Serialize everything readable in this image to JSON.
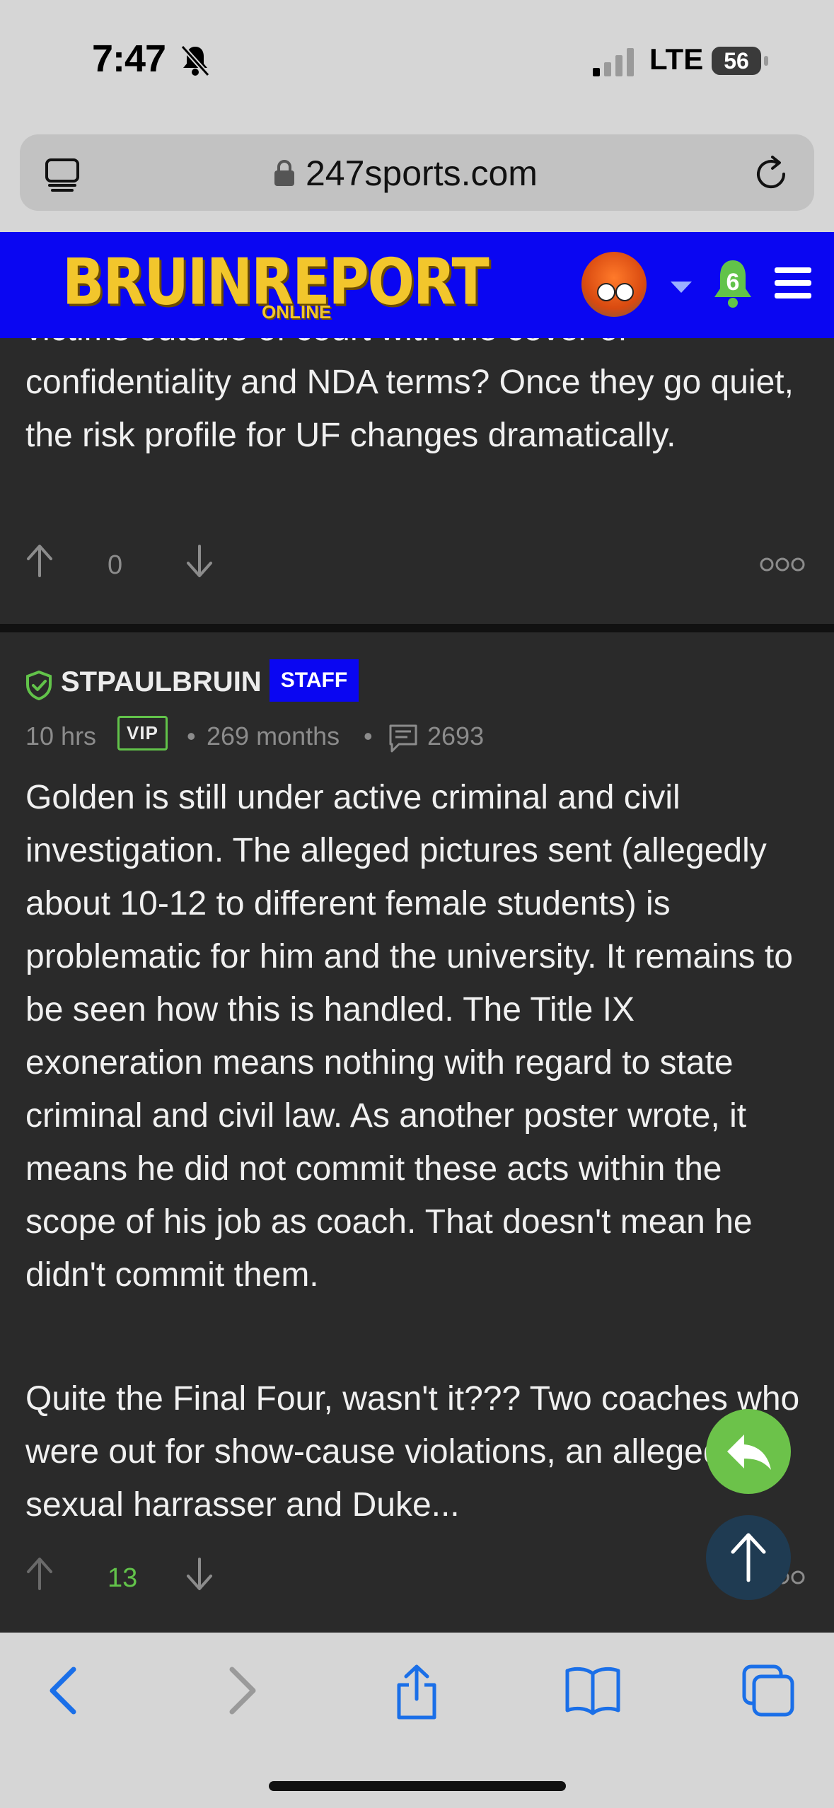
{
  "status_bar": {
    "time": "7:47",
    "network": "LTE",
    "battery": "56"
  },
  "browser": {
    "url": "247sports.com"
  },
  "site_header": {
    "logo_main": "BRUINREPORT",
    "logo_sub": "ONLINE",
    "notification_count": "6",
    "brand_color": "#0a06f2",
    "logo_color": "#f2c62c"
  },
  "post1": {
    "text_partial_top": "victims outside of court with the cover of",
    "text": "confidentiality and NDA terms? Once they go quiet, the risk profile for UF changes dramatically.",
    "vote_count": "0"
  },
  "post2": {
    "author": "STPAULBRUIN",
    "badge": "STAFF",
    "age": "10 hrs",
    "vip": "VIP",
    "tenure": "269 months",
    "post_count": "2693",
    "paragraph1": "Golden is still under active criminal and civil investigation. The alleged pictures sent (allegedly about 10-12 to different female students) is problematic for him and the university. It remains to be seen how this is handled. The Title IX exoneration means nothing with regard to state criminal and civil law. As another poster wrote, it means he did not commit these acts within the scope of his job as coach. That doesn't mean he didn't commit them.",
    "paragraph2": "Quite the Final Four, wasn't it??? Two coaches who were out for show-cause violations, an alleged sexual harrasser and Duke...",
    "vote_count": "13",
    "vote_color": "#62c34a"
  },
  "icons": [
    "tabs-icon",
    "lock-icon",
    "reload-icon",
    "avatar",
    "chevron-down-icon",
    "bell-icon",
    "menu-icon",
    "arrow-up-icon",
    "arrow-down-icon",
    "more-icon",
    "shield-check-icon",
    "comment-icon",
    "reply-icon",
    "back-icon",
    "forward-icon",
    "share-icon",
    "bookmarks-icon",
    "tabs-overview-icon"
  ]
}
